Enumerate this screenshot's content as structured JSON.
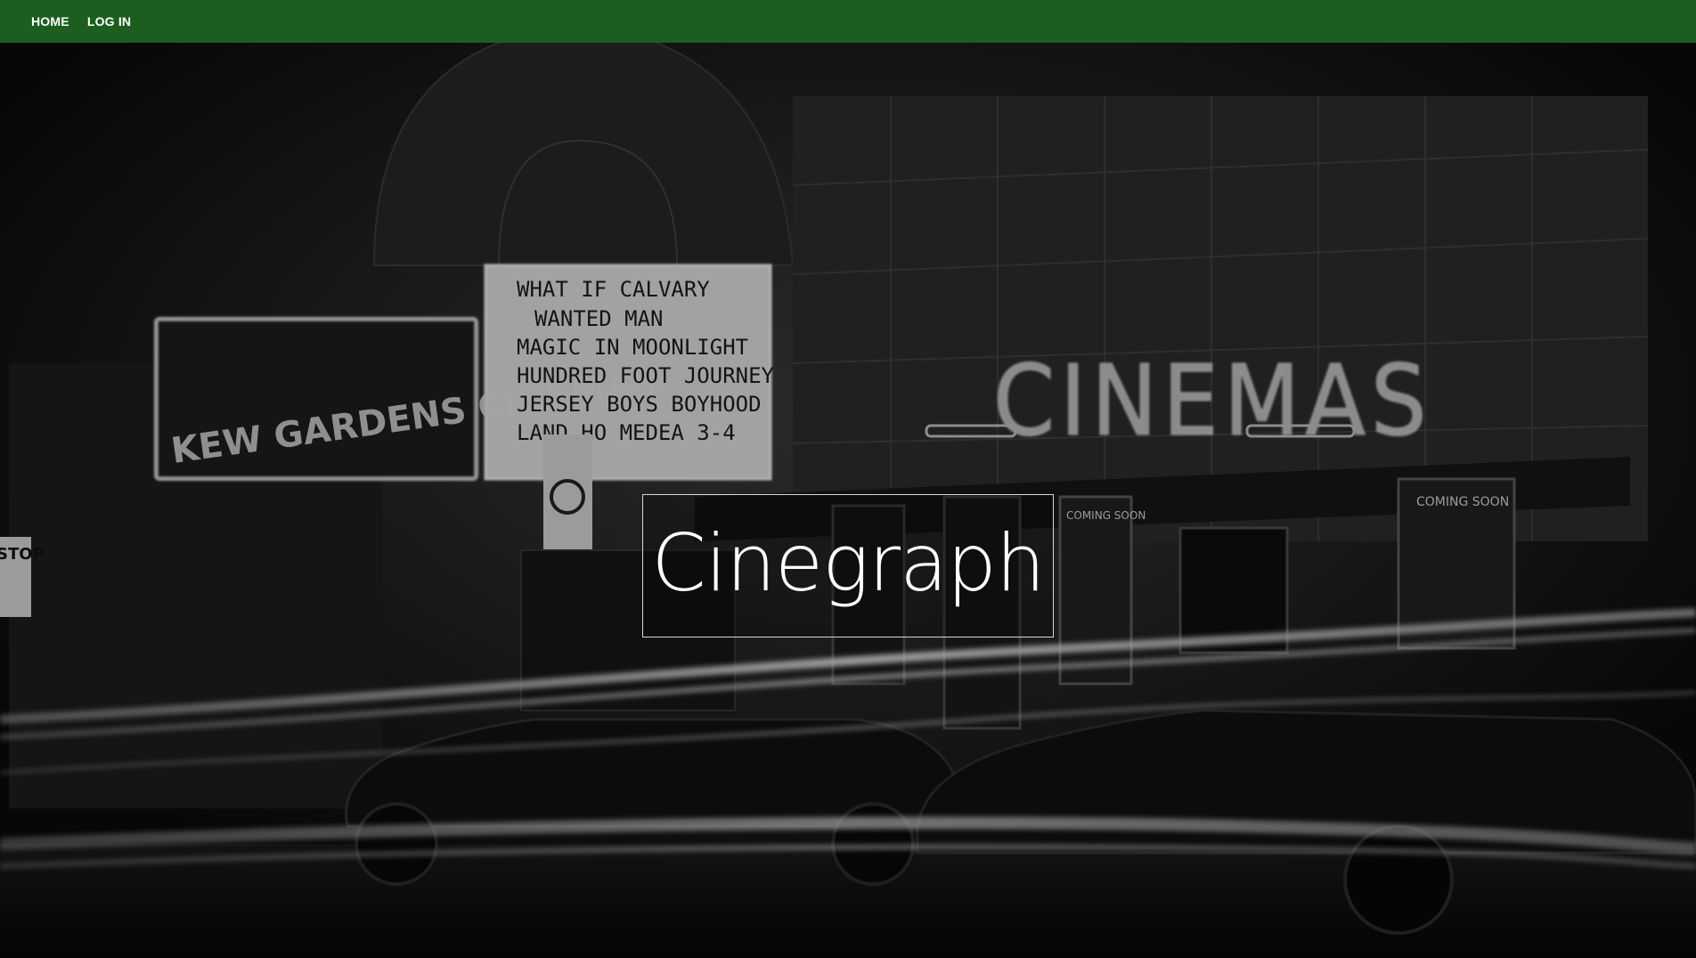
{
  "nav": {
    "home_label": "HOME",
    "login_label": "LOG IN"
  },
  "hero": {
    "title": "Cinegraph",
    "marquee_left": "KEW GARDENS CINEMAS",
    "marquee_right": "CINEMAS",
    "marquee_board": [
      "WHAT IF     CALVARY",
      "WANTED MAN",
      "MAGIC IN MOONLIGHT",
      "HUNDRED FOOT JOURNEY",
      "JERSEY BOYS  BOYHOOD",
      "LAND HO    MEDEA 3-4"
    ],
    "coming_soon_1": "COMING SOON",
    "coming_soon_2": "COMING SOON",
    "stop_sign": "STOP"
  },
  "colors": {
    "nav_background": "#1d5e20",
    "nav_text": "#ffffff",
    "title_text": "#ffffff",
    "title_border": "#d8d8d8"
  }
}
